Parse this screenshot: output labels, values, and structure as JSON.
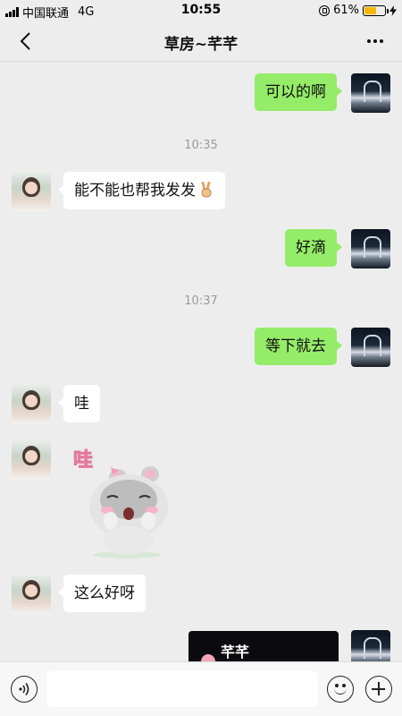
{
  "status_bar": {
    "carrier": "中国联通",
    "network": "4G",
    "time": "10:55",
    "battery_percent": "61%",
    "battery_level": 0.61,
    "icons": [
      "signal-icon",
      "orientation-lock-icon",
      "battery-icon",
      "charging-icon"
    ]
  },
  "nav": {
    "title": "草房~芊芊",
    "back_icon": "back-chevron-icon",
    "more_icon": "more-icon"
  },
  "messages": [
    {
      "sender": "self",
      "text": "可以的啊"
    },
    {
      "type": "timestamp",
      "text": "10:35"
    },
    {
      "sender": "other",
      "text": "能不能也帮我发发",
      "emoji": "victory-hand-icon"
    },
    {
      "sender": "self",
      "text": "好滴"
    },
    {
      "type": "timestamp",
      "text": "10:37"
    },
    {
      "sender": "self",
      "text": "等下就去"
    },
    {
      "sender": "other",
      "text": "哇"
    },
    {
      "sender": "other",
      "type": "sticker",
      "sticker_text": "哇",
      "sticker_name": "surprised-hamster-sticker"
    },
    {
      "sender": "other",
      "text": "这么好呀"
    },
    {
      "sender": "self",
      "type": "image",
      "image_text": "芊芊"
    }
  ],
  "input_bar": {
    "voice_icon": "voice-icon",
    "text_value": "",
    "emoji_icon": "emoji-icon",
    "plus_icon": "plus-icon"
  },
  "colors": {
    "outgoing_bubble": "#95ec69",
    "incoming_bubble": "#ffffff",
    "background": "#ededed",
    "timestamp": "#9a9a9a"
  }
}
